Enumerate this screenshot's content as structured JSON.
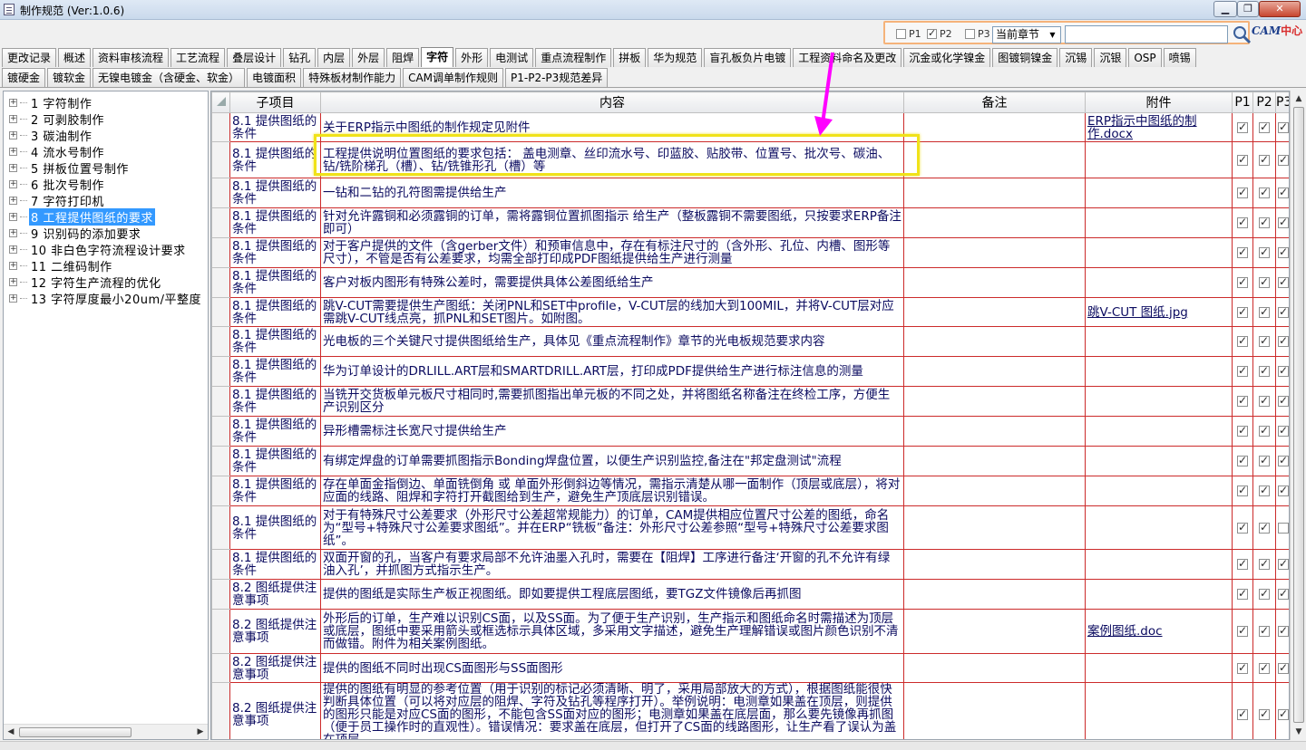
{
  "window": {
    "title": "制作规范 (Ver:1.0.6)"
  },
  "toolbar": {
    "p1": {
      "label": "P1",
      "checked": false
    },
    "p2": {
      "label": "P2",
      "checked": true
    },
    "p3": {
      "label": "P3",
      "checked": false
    },
    "scope": "当前章节",
    "search_value": "",
    "logo_a": "CAM",
    "logo_b": "中心",
    "colors": {
      "frame": "#f5b37a",
      "highlight": "#f0e21a",
      "arrow": "#ff00ff",
      "row_border": "#cc2b2b",
      "selection": "#3399ff"
    }
  },
  "tabs_row1": [
    "更改记录",
    "概述",
    "资料审核流程",
    "工艺流程",
    "叠层设计",
    "钻孔",
    "内层",
    "外层",
    "阻焊",
    "字符",
    "外形",
    "电测试",
    "重点流程制作",
    "拼板",
    "华为规范",
    "盲孔板负片电镀",
    "工程资料命名及更改",
    "沉金或化学镍金",
    "图镀铜镍金",
    "沉锡",
    "沉银",
    "OSP",
    "喷锡"
  ],
  "tabs_row2": [
    "镀硬金",
    "镀软金",
    "无镍电镀金（含硬金、软金）",
    "电镀面积",
    "特殊板材制作能力",
    "CAM调单制作规则",
    "P1-P2-P3规范差异"
  ],
  "active_tab": "字符",
  "tree": [
    {
      "label": "1  字符制作"
    },
    {
      "label": "2  可剥胶制作"
    },
    {
      "label": "3  碳油制作"
    },
    {
      "label": "4  流水号制作"
    },
    {
      "label": "5  拼板位置号制作"
    },
    {
      "label": "6  批次号制作"
    },
    {
      "label": "7  字符打印机"
    },
    {
      "label": "8  工程提供图纸的要求",
      "selected": true
    },
    {
      "label": "9  识别码的添加要求"
    },
    {
      "label": "10  非白色字符流程设计要求"
    },
    {
      "label": "11  二维码制作"
    },
    {
      "label": "12  字符生产流程的优化"
    },
    {
      "label": "13  字符厚度最小20um/平整度"
    }
  ],
  "grid": {
    "headers": [
      "子项目",
      "内容",
      "备注",
      "附件",
      "P1",
      "P2",
      "P3"
    ],
    "rows": [
      {
        "sub": "8.1 提供图纸的条件",
        "content": "关于ERP指示中图纸的制作规定见附件",
        "note": "",
        "attach": "ERP指示中图纸的制作.docx",
        "p1": true,
        "p2": true,
        "p3": true
      },
      {
        "sub": "8.1 提供图纸的条件",
        "content": "工程提供说明位置图纸的要求包括： 盖电测章、丝印流水号、印蓝胶、贴胶带、位置号、批次号、碳油、钻/铣阶梯孔（槽）、钻/铣锥形孔（槽）等",
        "note": "",
        "attach": "",
        "p1": true,
        "p2": true,
        "p3": true
      },
      {
        "sub": "8.1 提供图纸的条件",
        "content": "一钻和二钻的孔符图需提供给生产",
        "note": "",
        "attach": "",
        "p1": true,
        "p2": true,
        "p3": true
      },
      {
        "sub": "8.1 提供图纸的条件",
        "content": "针对允许露铜和必须露铜的订单，需将露铜位置抓图指示 给生产（整板露铜不需要图纸，只按要求ERP备注即可）",
        "note": "",
        "attach": "",
        "p1": true,
        "p2": true,
        "p3": true
      },
      {
        "sub": "8.1 提供图纸的条件",
        "content": "对于客户提供的文件（含gerber文件）和预审信息中，存在有标注尺寸的（含外形、孔位、内槽、图形等尺寸），不管是否有公差要求，均需全部打印成PDF图纸提供给生产进行测量",
        "note": "",
        "attach": "",
        "p1": true,
        "p2": true,
        "p3": true
      },
      {
        "sub": "8.1 提供图纸的条件",
        "content": "客户对板内图形有特殊公差时，需要提供具体公差图纸给生产",
        "note": "",
        "attach": "",
        "p1": true,
        "p2": true,
        "p3": true
      },
      {
        "sub": "8.1 提供图纸的条件",
        "content": "跳V-CUT需要提供生产图纸：关闭PNL和SET中profile，V-CUT层的线加大到100MIL，并将V-CUT层对应需跳V-CUT线点亮，抓PNL和SET图片。如附图。",
        "note": "",
        "attach": "跳V-CUT 图纸.jpg",
        "p1": true,
        "p2": true,
        "p3": true
      },
      {
        "sub": "8.1 提供图纸的条件",
        "content": "光电板的三个关键尺寸提供图纸给生产，具体见《重点流程制作》章节的光电板规范要求内容",
        "note": "",
        "attach": "",
        "p1": true,
        "p2": true,
        "p3": true
      },
      {
        "sub": "8.1 提供图纸的条件",
        "content": "华为订单设计的DRLILL.ART层和SMARTDRILL.ART层，打印成PDF提供给生产进行标注信息的测量",
        "note": "",
        "attach": "",
        "p1": true,
        "p2": true,
        "p3": true
      },
      {
        "sub": "8.1 提供图纸的条件",
        "content": "当铣开交货板单元板尺寸相同时,需要抓图指出单元板的不同之处，并将图纸名称备注在终检工序，方便生产识别区分",
        "note": "",
        "attach": "",
        "p1": true,
        "p2": true,
        "p3": true
      },
      {
        "sub": "8.1 提供图纸的条件",
        "content": "异形槽需标注长宽尺寸提供给生产",
        "note": "",
        "attach": "",
        "p1": true,
        "p2": true,
        "p3": true
      },
      {
        "sub": "8.1 提供图纸的条件",
        "content": "有绑定焊盘的订单需要抓图指示Bonding焊盘位置，以便生产识别监控,备注在\"邦定盘测试\"流程",
        "note": "",
        "attach": "",
        "p1": true,
        "p2": true,
        "p3": true
      },
      {
        "sub": "8.1 提供图纸的条件",
        "content": "存在单面金指倒边、单面铣倒角 或 单面外形倒斜边等情况，需指示清楚从哪一面制作（顶层或底层），将对应面的线路、阻焊和字符打开截图给到生产，避免生产顶底层识别错误。",
        "note": "",
        "attach": "",
        "p1": true,
        "p2": true,
        "p3": true
      },
      {
        "sub": "8.1 提供图纸的条件",
        "content": "对于有特殊尺寸公差要求（外形尺寸公差超常规能力）的订单，CAM提供相应位置尺寸公差的图纸，命名为“型号+特殊尺寸公差要求图纸”。并在ERP“铣板”备注：外形尺寸公差参照“型号+特殊尺寸公差要求图纸”。",
        "note": "",
        "attach": "",
        "p1": true,
        "p2": true,
        "p3": false
      },
      {
        "sub": "8.1 提供图纸的条件",
        "content": "双面开窗的孔，当客户有要求局部不允许油墨入孔时，需要在【阻焊】工序进行备注‘开窗的孔不允许有绿油入孔’，并抓图方式指示生产。",
        "note": "",
        "attach": "",
        "p1": true,
        "p2": true,
        "p3": true
      },
      {
        "sub": "8.2 图纸提供注意事项",
        "content": "提供的图纸是实际生产板正视图纸。即如要提供工程底层图纸，要TGZ文件镜像后再抓图",
        "note": "",
        "attach": "",
        "p1": true,
        "p2": true,
        "p3": true
      },
      {
        "sub": "8.2 图纸提供注意事项",
        "content": "外形后的订单，生产难以识别CS面，以及SS面。为了便于生产识别，生产指示和图纸命名时需描述为顶层或底层，图纸中要采用箭头或框选标示具体区域，多采用文字描述，避免生产理解错误或图片颜色识别不清而做错。附件为相关案例图纸。",
        "note": "",
        "attach": "案例图纸.doc",
        "p1": true,
        "p2": true,
        "p3": true
      },
      {
        "sub": "8.2 图纸提供注意事项",
        "content": "提供的图纸不同时出现CS面图形与SS面图形",
        "note": "",
        "attach": "",
        "p1": true,
        "p2": true,
        "p3": true
      },
      {
        "sub": "8.2 图纸提供注意事项",
        "content": "提供的图纸有明显的参考位置（用于识别的标记必须清晰、明了，采用局部放大的方式），根据图纸能很快判断具体位置（可以将对应层的阻焊、字符及钻孔等程序打开）。举例说明：电测章如果盖在顶层，则提供的图形只能是对应CS面的图形，不能包含SS面对应的图形；电测章如果盖在底层面，那么要先镜像再抓图（便于员工操作时的直观性）。错误情况：要求盖在底层，但打开了CS面的线路图形，让生产看了误认为盖在顶层。",
        "note": "",
        "attach": "",
        "p1": true,
        "p2": true,
        "p3": true
      }
    ]
  }
}
